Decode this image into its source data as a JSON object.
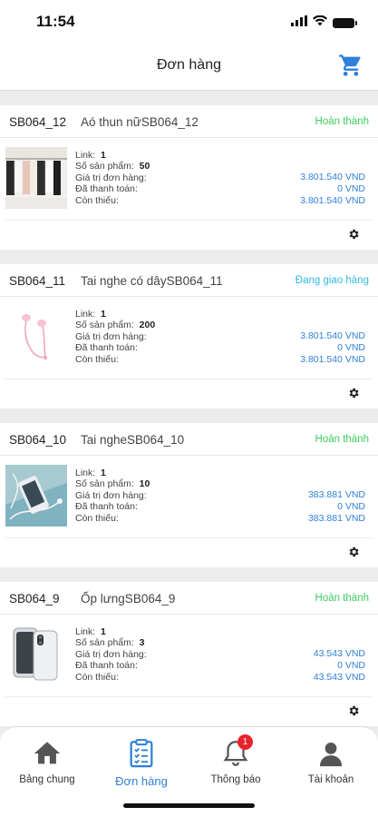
{
  "status_bar": {
    "time": "11:54"
  },
  "header": {
    "title": "Đơn hàng",
    "cart_icon": "cart-icon"
  },
  "labels": {
    "link": "Link:",
    "product_count": "Số sản phẩm:",
    "order_value": "Giá trị đơn hàng:",
    "paid": "Đã thanh toán:",
    "remaining": "Còn thiếu:"
  },
  "orders": [
    {
      "code": "SB064_12",
      "name": "Aó thun nữSB064_12",
      "status": "Hoàn thành",
      "link": "1",
      "products": "50",
      "value": "3.801.540 VND",
      "paid": "0 VND",
      "remaining": "3.801.540 VND"
    },
    {
      "code": "SB064_11",
      "name": "Tai nghe có dâySB064_11",
      "status": "Đang giao hàng",
      "link": "1",
      "products": "200",
      "value": "3.801.540 VND",
      "paid": "0 VND",
      "remaining": "3.801.540 VND"
    },
    {
      "code": "SB064_10",
      "name": "Tai ngheSB064_10",
      "status": "Hoàn thành",
      "link": "1",
      "products": "10",
      "value": "383.881 VND",
      "paid": "0 VND",
      "remaining": "383.881 VND"
    },
    {
      "code": "SB064_9",
      "name": "Ốp lưngSB064_9",
      "status": "Hoàn thành",
      "link": "1",
      "products": "3",
      "value": "43.543 VND",
      "paid": "0 VND",
      "remaining": "43.543 VND"
    }
  ],
  "tabs": [
    {
      "label": "Bảng chung",
      "icon": "home-icon"
    },
    {
      "label": "Đơn hàng",
      "icon": "clipboard-icon"
    },
    {
      "label": "Thông báo",
      "icon": "bell-icon",
      "badge": "1"
    },
    {
      "label": "Tài khoản",
      "icon": "user-icon"
    }
  ],
  "colors": {
    "accent": "#2f80d8",
    "status_done": "#3dcb5f",
    "status_shipping": "#35b9e6",
    "badge": "#e8242a"
  }
}
